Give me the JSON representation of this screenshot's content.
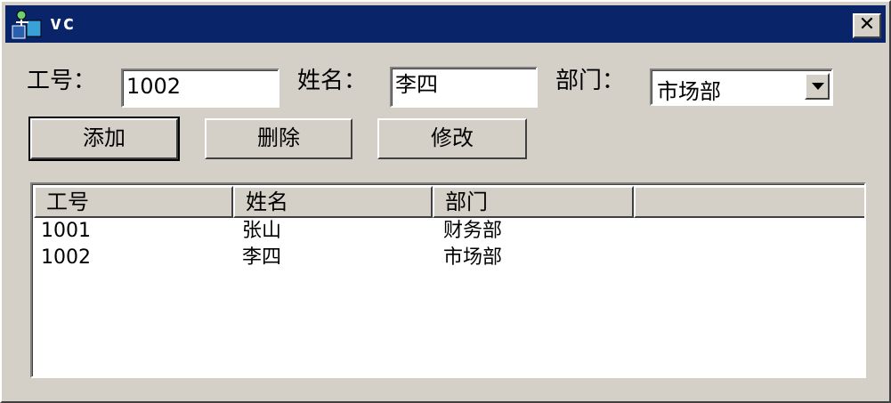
{
  "window": {
    "title": "vc",
    "close_glyph": "✕"
  },
  "form": {
    "id_label": "工号：",
    "id_value": "1002",
    "name_label": "姓名：",
    "name_value": "李四",
    "dept_label": "部门：",
    "dept_selected": "市场部"
  },
  "buttons": {
    "add": "添加",
    "delete": "删除",
    "modify": "修改"
  },
  "list": {
    "columns": [
      "工号",
      "姓名",
      "部门",
      ""
    ],
    "rows": [
      [
        "1001",
        "张山",
        "财务部"
      ],
      [
        "1002",
        "李四",
        "市场部"
      ]
    ]
  },
  "colors": {
    "titlebar": "#0a246a",
    "face": "#d4d0c8"
  },
  "icons": {
    "app": "app-icon",
    "close": "close-icon",
    "dropdown": "chevron-down-icon"
  }
}
